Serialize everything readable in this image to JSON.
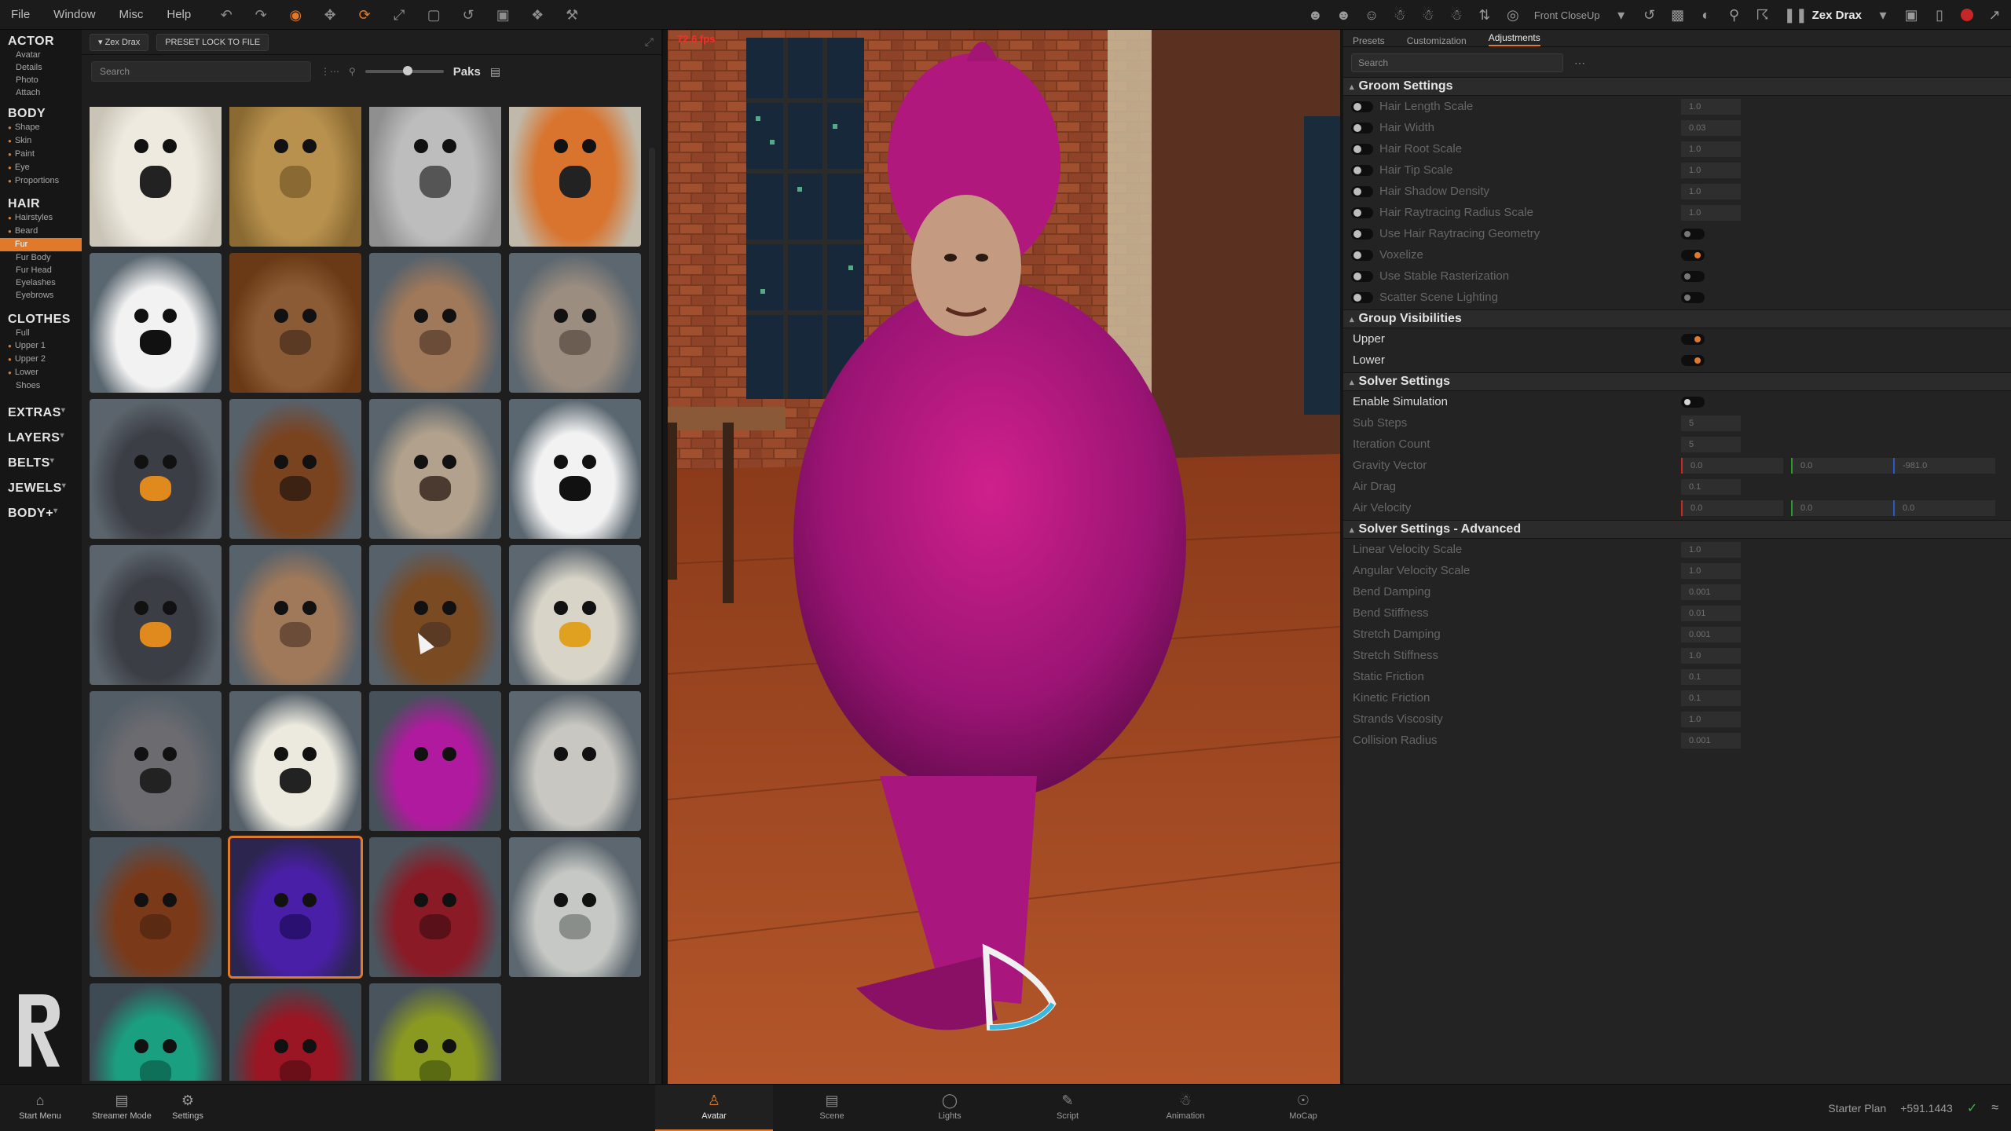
{
  "menubar": {
    "items": [
      "File",
      "Window",
      "Misc",
      "Help"
    ]
  },
  "topright": {
    "view_mode": "Front CloseUp",
    "avatar_name": "Zex Drax"
  },
  "leftnav": {
    "sections": [
      {
        "title": "ACTOR",
        "items": [
          "Avatar",
          "Details",
          "Photo",
          "Attach"
        ]
      },
      {
        "title": "BODY",
        "items": [
          "Shape",
          "Skin",
          "Paint",
          "Eye",
          "Proportions"
        ]
      },
      {
        "title": "HAIR",
        "items": [
          "Hairstyles",
          "Beard",
          "Fur",
          "Fur Body",
          "Fur Head",
          "Eyelashes",
          "Eyebrows"
        ]
      },
      {
        "title": "CLOTHES",
        "items": [
          "Full",
          "Upper 1",
          "Upper 2",
          "Lower",
          "Shoes"
        ]
      }
    ],
    "collapsed": [
      "EXTRAS",
      "LAYERS",
      "BELTS",
      "JEWELS",
      "BODY+"
    ]
  },
  "library": {
    "actor_pill": "Zex Drax",
    "preset_button": "PRESET LOCK TO FILE",
    "search_placeholder": "Search",
    "paks_label": "Paks"
  },
  "tiles": [
    {
      "name": "polar-bear-face",
      "bg": "#c9c4b6",
      "fg": "#eeeae0",
      "snout": "#222"
    },
    {
      "name": "lion-mane",
      "bg": "#8a6a32",
      "fg": "#b8914e",
      "snout": "#8a6a32"
    },
    {
      "name": "wolf-face",
      "bg": "#8f8f8f",
      "fg": "#bdbdbd",
      "snout": "#555"
    },
    {
      "name": "fox-face",
      "bg": "#c0b8a8",
      "fg": "#d8742e",
      "snout": "#222"
    },
    {
      "name": "panda-face",
      "bg": "#5b6770",
      "fg": "#f2f2f2",
      "snout": "#111"
    },
    {
      "name": "monkey-face",
      "bg": "#6a3a16",
      "fg": "#8a5b34",
      "snout": "#5a3a22"
    },
    {
      "name": "lioness-face",
      "bg": "#58626b",
      "fg": "#a0795a",
      "snout": "#6a4c38"
    },
    {
      "name": "cat-face",
      "bg": "#5d676f",
      "fg": "#9b8d80",
      "snout": "#6b5d52"
    },
    {
      "name": "duck-face",
      "bg": "#5b646c",
      "fg": "#3c3e45",
      "snout": "#e08a1e"
    },
    {
      "name": "bull-face",
      "bg": "#57616a",
      "fg": "#7a4320",
      "snout": "#3b2212"
    },
    {
      "name": "otter-face",
      "bg": "#5a646c",
      "fg": "#b2a18c",
      "snout": "#4a3a30"
    },
    {
      "name": "panda-face-2",
      "bg": "#5b6770",
      "fg": "#f2f2f2",
      "snout": "#111"
    },
    {
      "name": "duck-face-2",
      "bg": "#5b646c",
      "fg": "#3c3e45",
      "snout": "#e08a1e"
    },
    {
      "name": "lioness-face-2",
      "bg": "#58626b",
      "fg": "#a0795a",
      "snout": "#6a4c38"
    },
    {
      "name": "monkey-face-2",
      "bg": "#57616a",
      "fg": "#7a4a22",
      "snout": "#5a3a22"
    },
    {
      "name": "eagle-face",
      "bg": "#5d676f",
      "fg": "#d8d4c8",
      "snout": "#e0a020"
    },
    {
      "name": "koala-face",
      "bg": "#535d66",
      "fg": "#6b6b70",
      "snout": "#222"
    },
    {
      "name": "polar-bear-face-2",
      "bg": "#57616a",
      "fg": "#eceadf",
      "snout": "#222"
    },
    {
      "name": "pink-fur",
      "bg": "#47515a",
      "fg": "#b01a9e",
      "snout": "#b01a9e"
    },
    {
      "name": "white-fur",
      "bg": "#5d676f",
      "fg": "#c8c7c1",
      "snout": "#c8c7c1"
    },
    {
      "name": "brown-furry-creature",
      "bg": "#4b555e",
      "fg": "#7a3a1a",
      "snout": "#5a2a12"
    },
    {
      "name": "purple-furry-creature",
      "bg": "#2c2550",
      "fg": "#4a1fa8",
      "snout": "#2a1070"
    },
    {
      "name": "red-furry-creature",
      "bg": "#4b555e",
      "fg": "#8a1a26",
      "snout": "#5a1018"
    },
    {
      "name": "white-furry-creature",
      "bg": "#5d676f",
      "fg": "#c5c8c4",
      "snout": "#8a8e8a"
    },
    {
      "name": "teal-furry-creature",
      "bg": "#3e4a54",
      "fg": "#1aa080",
      "snout": "#0e7058"
    },
    {
      "name": "crimson-furry-creature",
      "bg": "#3e4850",
      "fg": "#9a1624",
      "snout": "#6a0e18"
    },
    {
      "name": "lime-furry-creature",
      "bg": "#4a545c",
      "fg": "#8a9a20",
      "snout": "#5a6a12"
    }
  ],
  "viewport": {
    "fps": "72.6 fps"
  },
  "rpanel": {
    "tabs": [
      "Presets",
      "Customization",
      "Adjustments"
    ],
    "search_placeholder": "Search",
    "groom_title": "Groom Settings",
    "groom_rows": [
      {
        "label": "Hair Length Scale",
        "value": "1.0"
      },
      {
        "label": "Hair Width",
        "value": "0.03"
      },
      {
        "label": "Hair Root Scale",
        "value": "1.0"
      },
      {
        "label": "Hair Tip Scale",
        "value": "1.0"
      },
      {
        "label": "Hair Shadow Density",
        "value": "1.0"
      },
      {
        "label": "Hair Raytracing Radius Scale",
        "value": "1.0"
      }
    ],
    "groom_toggles": [
      "Use Hair Raytracing Geometry",
      "Voxelize",
      "Use Stable Rasterization",
      "Scatter Scene Lighting"
    ],
    "visibility_title": "Group Visibilities",
    "visibility_rows": [
      "Upper",
      "Lower"
    ],
    "solver_title": "Solver Settings",
    "solver_enable": "Enable Simulation",
    "solver_rows": [
      {
        "label": "Sub Steps",
        "value": "5"
      },
      {
        "label": "Iteration Count",
        "value": "5"
      }
    ],
    "gravity_label": "Gravity Vector",
    "gravity_values": [
      "0.0",
      "0.0",
      "-981.0"
    ],
    "air_drag": {
      "label": "Air Drag",
      "value": "0.1"
    },
    "air_velocity_label": "Air Velocity",
    "air_velocity_values": [
      "0.0",
      "0.0",
      "0.0"
    ],
    "advanced_title": "Solver Settings - Advanced",
    "advanced_rows": [
      {
        "label": "Linear Velocity Scale",
        "value": "1.0"
      },
      {
        "label": "Angular Velocity Scale",
        "value": "1.0"
      },
      {
        "label": "Bend Damping",
        "value": "0.001"
      },
      {
        "label": "Bend Stiffness",
        "value": "0.01"
      },
      {
        "label": "Stretch Damping",
        "value": "0.001"
      },
      {
        "label": "Stretch Stiffness",
        "value": "1.0"
      },
      {
        "label": "Static Friction",
        "value": "0.1"
      },
      {
        "label": "Kinetic Friction",
        "value": "0.1"
      },
      {
        "label": "Strands Viscosity",
        "value": "1.0"
      },
      {
        "label": "Collision Radius",
        "value": "0.001"
      }
    ]
  },
  "bottombar": {
    "left": [
      "Start Menu",
      "Streamer Mode",
      "Settings"
    ],
    "tabs": [
      "Avatar",
      "Scene",
      "Lights",
      "Script",
      "Animation",
      "MoCap"
    ],
    "plan": "Starter Plan",
    "coords": "+591.1443"
  },
  "colors": {
    "accent": "#e07a2a",
    "panel": "#232323"
  }
}
